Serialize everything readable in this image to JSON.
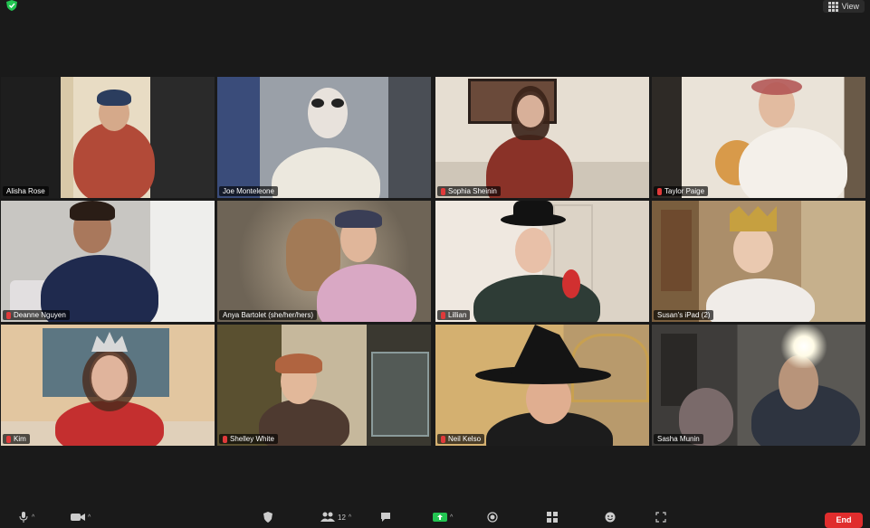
{
  "top_bar": {
    "view_label": "View"
  },
  "participants": [
    {
      "name": "Alisha Rose",
      "muted": false
    },
    {
      "name": "Joe Monteleone",
      "muted": false,
      "active_speaker": true
    },
    {
      "name": "Sophia Sheinin",
      "muted": true
    },
    {
      "name": "Taylor Paige",
      "muted": true
    },
    {
      "name": "Deanne Nguyen",
      "muted": true
    },
    {
      "name": "Anya Bartolet  (she/her/hers)",
      "muted": false
    },
    {
      "name": "Lillian",
      "muted": true
    },
    {
      "name": "Susan's iPad (2)",
      "muted": false
    },
    {
      "name": "Kim",
      "muted": true
    },
    {
      "name": "Shelley White",
      "muted": true
    },
    {
      "name": "Neil Kelso",
      "muted": true
    },
    {
      "name": "Sasha Munin",
      "muted": false
    }
  ],
  "toolbar": {
    "participants_count": "12",
    "end_label": "End"
  },
  "colors": {
    "accent_active": "#e6e27a",
    "end_button": "#e02d2d",
    "mute_red": "#e03a3a",
    "share_green": "#23c552"
  }
}
